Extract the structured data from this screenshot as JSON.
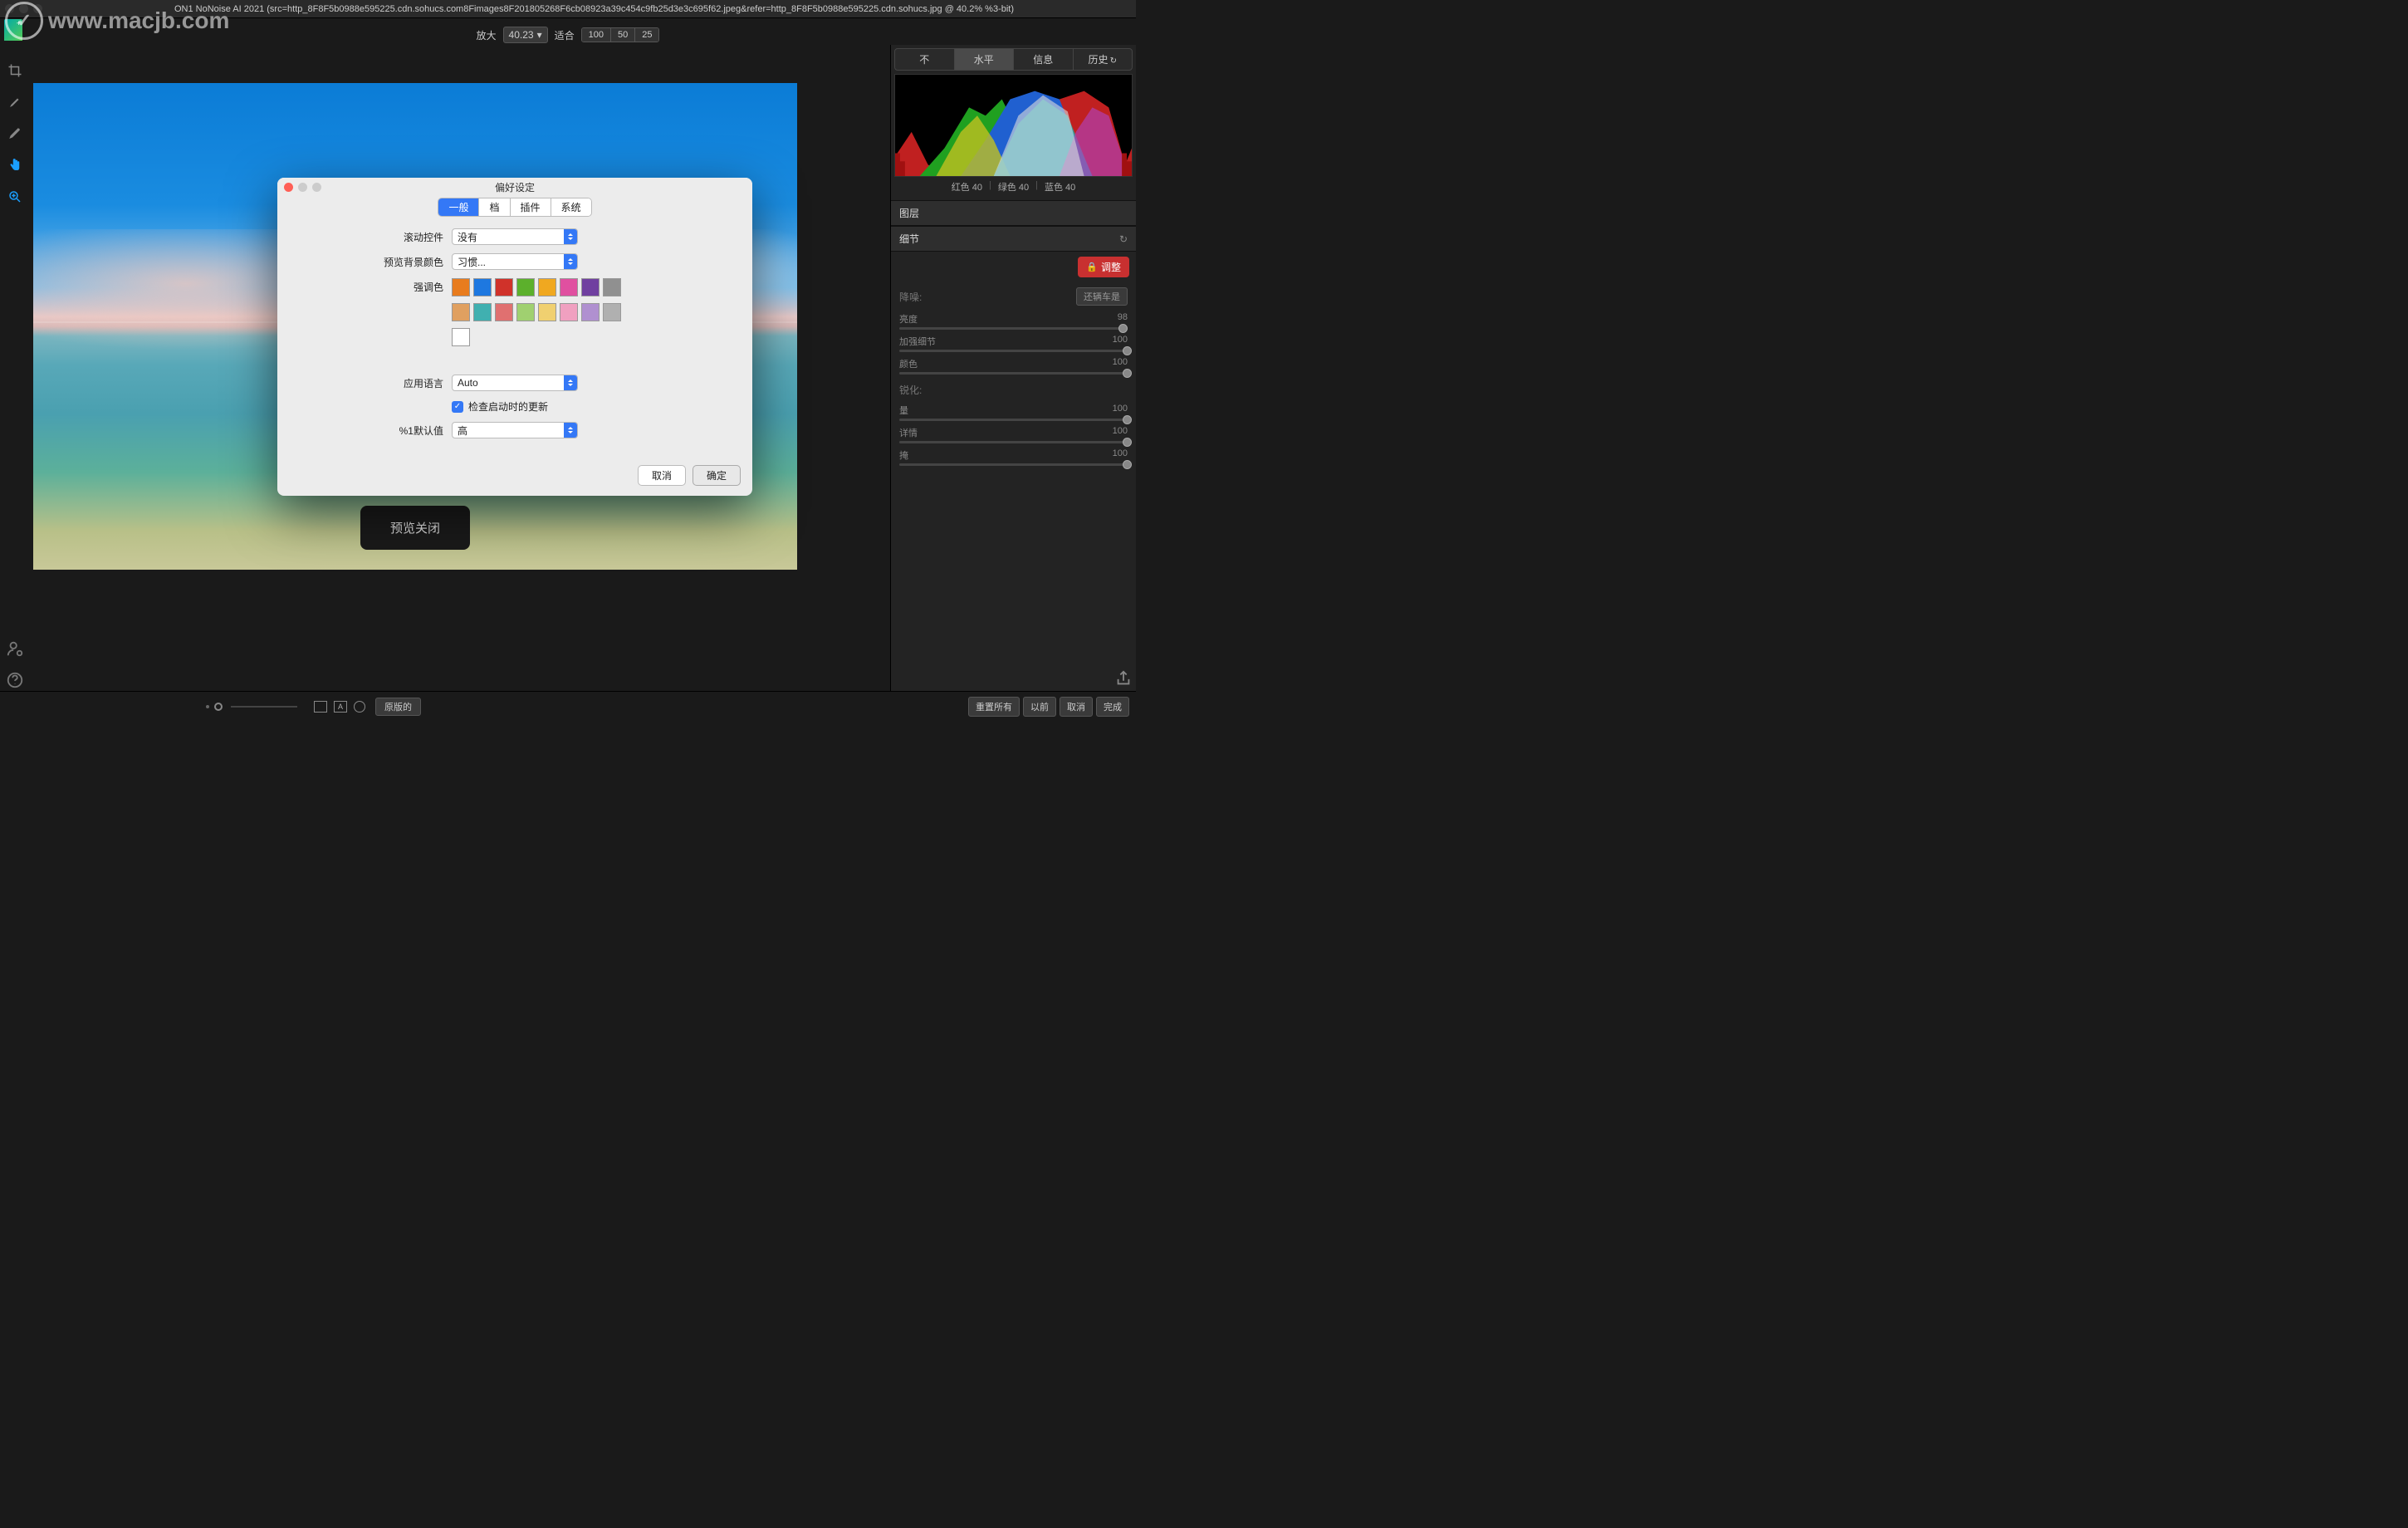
{
  "title": "ON1 NoNoise AI 2021 (src=http_8F8F5b0988e595225.cdn.sohucs.com8Fimages8F201805268F6cb08923a39c454c9fb25d3e3c695f62.jpeg&refer=http_8F8F5b0988e595225.cdn.sohucs.jpg @ 40.2% %3-bit)",
  "watermark": "www.macjb.com",
  "zoom": {
    "label": "放大",
    "value": "40.23",
    "fit": "适合",
    "opts": [
      "100",
      "50",
      "25"
    ]
  },
  "right_tabs": [
    "不",
    "水平",
    "信息",
    "历史"
  ],
  "right_tabs_active": 1,
  "hist_labels": {
    "r": "红色  40",
    "g": "绿色  40",
    "b": "蓝色  40"
  },
  "panel_layers": "图层",
  "panel_detail": "细节",
  "adjust_btn": "调整",
  "noise": {
    "label": "降噪:",
    "btn": "还辆车是"
  },
  "sliders_a": [
    {
      "label": "亮度",
      "val": "98",
      "pos": 98
    },
    {
      "label": "加强细节",
      "val": "100",
      "pos": 100
    },
    {
      "label": "颜色",
      "val": "100",
      "pos": 100
    }
  ],
  "sharpen": {
    "label": "锐化:"
  },
  "sliders_b": [
    {
      "label": "量",
      "val": "100",
      "pos": 100
    },
    {
      "label": "详情",
      "val": "100",
      "pos": 100
    },
    {
      "label": "掩",
      "val": "100",
      "pos": 100
    }
  ],
  "preview_off": "预览关闭",
  "bottom": {
    "orig": "原版的",
    "reset_all": "重置所有",
    "before": "以前",
    "cancel": "取消",
    "done": "完成"
  },
  "dialog": {
    "title": "偏好设定",
    "tabs": [
      "一般",
      "档",
      "插件",
      "系统"
    ],
    "active_tab": 0,
    "rows": {
      "scroll": {
        "label": "滚动控件",
        "value": "没有"
      },
      "bg": {
        "label": "预览背景颜色",
        "value": "习惯..."
      },
      "accent": {
        "label": "强调色"
      },
      "lang": {
        "label": "应用语言",
        "value": "Auto"
      },
      "check_updates": "检查启动时的更新",
      "default": {
        "label": "%1默认值",
        "value": "高"
      }
    },
    "swatches": [
      "#e87c1e",
      "#1e78e0",
      "#d0322a",
      "#5cb02c",
      "#f0a820",
      "#e050a0",
      "#7040a0",
      "#909090",
      "#e0a060",
      "#40b0b0",
      "#e07070",
      "#a0d070",
      "#f0d070",
      "#f0a0c0",
      "#b090d0",
      "#b0b0b0",
      "#ffffff"
    ],
    "cancel": "取消",
    "ok": "确定"
  }
}
